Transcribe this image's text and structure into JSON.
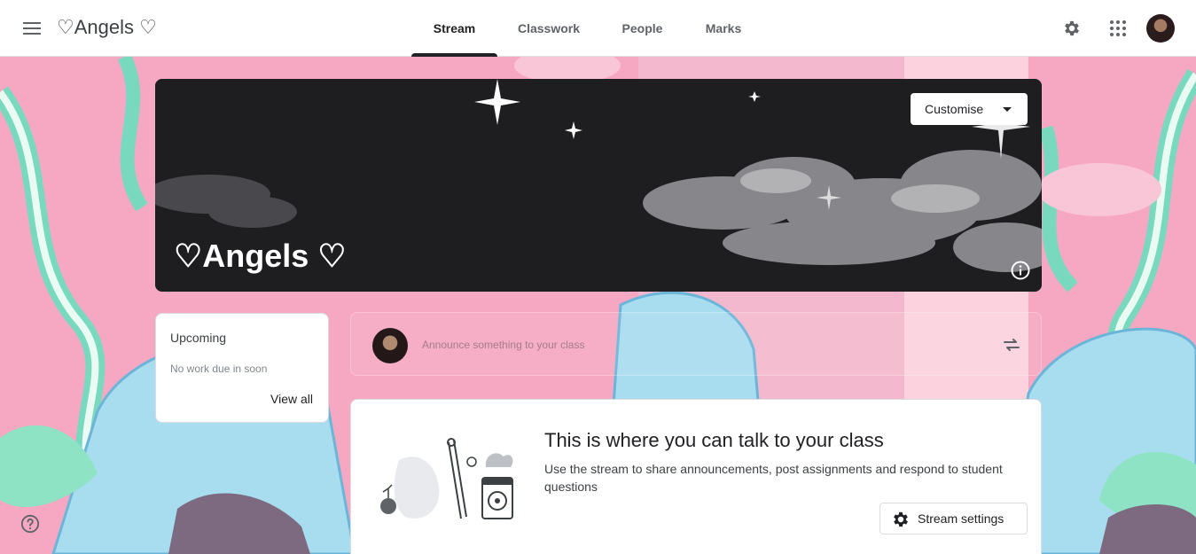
{
  "header": {
    "menu_icon": "hamburger-menu-icon",
    "class_name": "♡Angels ♡",
    "tabs": [
      {
        "label": "Stream",
        "active": true
      },
      {
        "label": "Classwork",
        "active": false
      },
      {
        "label": "People",
        "active": false
      },
      {
        "label": "Marks",
        "active": false
      }
    ],
    "settings_icon": "gear-icon",
    "apps_icon": "apps-grid-icon"
  },
  "banner": {
    "title": "♡Angels ♡",
    "customise_label": "Customise",
    "info_icon": "info-icon"
  },
  "upcoming": {
    "title": "Upcoming",
    "empty_text": "No work due in soon",
    "view_all_label": "View all"
  },
  "announce": {
    "placeholder": "Announce something to your class",
    "repost_icon": "repost-icon"
  },
  "stream_info": {
    "heading": "This is where you can talk to your class",
    "description": "Use the stream to share announcements, post assignments and respond to student questions",
    "settings_button_label": "Stream settings"
  },
  "colors": {
    "accent": "#202124",
    "background": "#f7a9c4"
  }
}
